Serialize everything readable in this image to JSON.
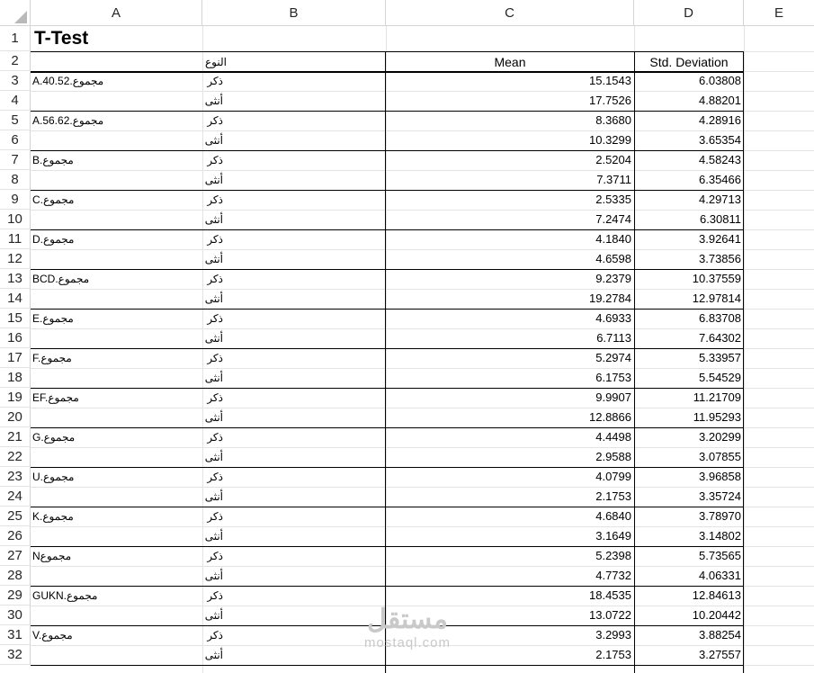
{
  "columns": [
    "A",
    "B",
    "C",
    "D",
    "E"
  ],
  "row_numbers": [
    "1",
    "2",
    "3",
    "4",
    "5",
    "6",
    "7",
    "8",
    "9",
    "10",
    "11",
    "12",
    "13",
    "14",
    "15",
    "16",
    "17",
    "18",
    "19",
    "20",
    "21",
    "22",
    "23",
    "24",
    "25",
    "26",
    "27",
    "28",
    "29",
    "30",
    "31",
    "32"
  ],
  "title": "T-Test",
  "headers": {
    "type": "النوع",
    "mean": "Mean",
    "std": "Std. Deviation"
  },
  "groups": [
    {
      "label": "A.40.52.مجموع",
      "rows": [
        {
          "type": "ذكر",
          "mean": "15.1543",
          "std": "6.03808"
        },
        {
          "type": "أنثى",
          "mean": "17.7526",
          "std": "4.88201"
        }
      ]
    },
    {
      "label": "A.56.62.مجموع",
      "rows": [
        {
          "type": "ذكر",
          "mean": "8.3680",
          "std": "4.28916"
        },
        {
          "type": "أنثى",
          "mean": "10.3299",
          "std": "3.65354"
        }
      ]
    },
    {
      "label": "B.مجموع",
      "rows": [
        {
          "type": "ذكر",
          "mean": "2.5204",
          "std": "4.58243"
        },
        {
          "type": "أنثى",
          "mean": "7.3711",
          "std": "6.35466"
        }
      ]
    },
    {
      "label": "C.مجموع",
      "rows": [
        {
          "type": "ذكر",
          "mean": "2.5335",
          "std": "4.29713"
        },
        {
          "type": "أنثى",
          "mean": "7.2474",
          "std": "6.30811"
        }
      ]
    },
    {
      "label": "D.مجموع",
      "rows": [
        {
          "type": "ذكر",
          "mean": "4.1840",
          "std": "3.92641"
        },
        {
          "type": "أنثى",
          "mean": "4.6598",
          "std": "3.73856"
        }
      ]
    },
    {
      "label": "BCD.مجموع",
      "rows": [
        {
          "type": "ذكر",
          "mean": "9.2379",
          "std": "10.37559"
        },
        {
          "type": "أنثى",
          "mean": "19.2784",
          "std": "12.97814"
        }
      ]
    },
    {
      "label": "E.مجموع",
      "rows": [
        {
          "type": "ذكر",
          "mean": "4.6933",
          "std": "6.83708"
        },
        {
          "type": "أنثى",
          "mean": "6.7113",
          "std": "7.64302"
        }
      ]
    },
    {
      "label": "F.مجموع",
      "rows": [
        {
          "type": "ذكر",
          "mean": "5.2974",
          "std": "5.33957"
        },
        {
          "type": "أنثى",
          "mean": "6.1753",
          "std": "5.54529"
        }
      ]
    },
    {
      "label": "EF.مجموع",
      "rows": [
        {
          "type": "ذكر",
          "mean": "9.9907",
          "std": "11.21709"
        },
        {
          "type": "أنثى",
          "mean": "12.8866",
          "std": "11.95293"
        }
      ]
    },
    {
      "label": "G.مجموع",
      "rows": [
        {
          "type": "ذكر",
          "mean": "4.4498",
          "std": "3.20299"
        },
        {
          "type": "أنثى",
          "mean": "2.9588",
          "std": "3.07855"
        }
      ]
    },
    {
      "label": "U.مجموع",
      "rows": [
        {
          "type": "ذكر",
          "mean": "4.0799",
          "std": "3.96858"
        },
        {
          "type": "أنثى",
          "mean": "2.1753",
          "std": "3.35724"
        }
      ]
    },
    {
      "label": "K.مجموع",
      "rows": [
        {
          "type": "ذكر",
          "mean": "4.6840",
          "std": "3.78970"
        },
        {
          "type": "أنثى",
          "mean": "3.1649",
          "std": "3.14802"
        }
      ]
    },
    {
      "label": "Nمجموع",
      "rows": [
        {
          "type": "ذكر",
          "mean": "5.2398",
          "std": "5.73565"
        },
        {
          "type": "أنثى",
          "mean": "4.7732",
          "std": "4.06331"
        }
      ]
    },
    {
      "label": "GUKN.مجموع",
      "rows": [
        {
          "type": "ذكر",
          "mean": "18.4535",
          "std": "12.84613"
        },
        {
          "type": "أنثى",
          "mean": "13.0722",
          "std": "10.20442"
        }
      ]
    },
    {
      "label": "V.مجموع",
      "rows": [
        {
          "type": "ذكر",
          "mean": "3.2993",
          "std": "3.88254"
        },
        {
          "type": "أنثى",
          "mean": "2.1753",
          "std": "3.27557"
        }
      ]
    }
  ],
  "watermark": {
    "arabic": "مستقل",
    "latin": "mostaql.com"
  }
}
